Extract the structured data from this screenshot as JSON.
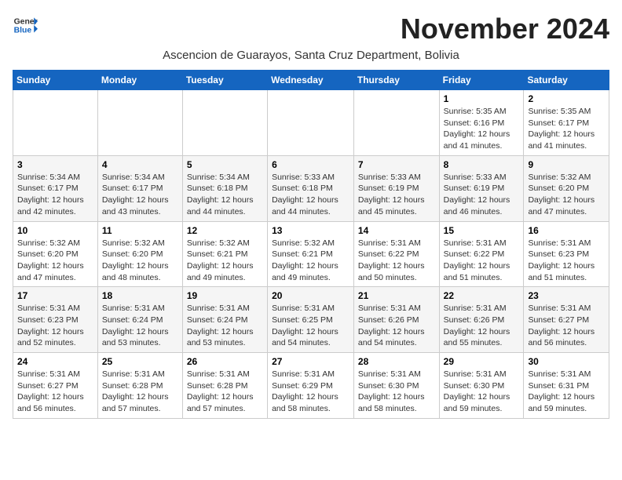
{
  "logo": {
    "line1": "General",
    "line2": "Blue"
  },
  "title": "November 2024",
  "subtitle": "Ascencion de Guarayos, Santa Cruz Department, Bolivia",
  "weekdays": [
    "Sunday",
    "Monday",
    "Tuesday",
    "Wednesday",
    "Thursday",
    "Friday",
    "Saturday"
  ],
  "weeks": [
    [
      {
        "day": "",
        "info": ""
      },
      {
        "day": "",
        "info": ""
      },
      {
        "day": "",
        "info": ""
      },
      {
        "day": "",
        "info": ""
      },
      {
        "day": "",
        "info": ""
      },
      {
        "day": "1",
        "info": "Sunrise: 5:35 AM\nSunset: 6:16 PM\nDaylight: 12 hours\nand 41 minutes."
      },
      {
        "day": "2",
        "info": "Sunrise: 5:35 AM\nSunset: 6:17 PM\nDaylight: 12 hours\nand 41 minutes."
      }
    ],
    [
      {
        "day": "3",
        "info": "Sunrise: 5:34 AM\nSunset: 6:17 PM\nDaylight: 12 hours\nand 42 minutes."
      },
      {
        "day": "4",
        "info": "Sunrise: 5:34 AM\nSunset: 6:17 PM\nDaylight: 12 hours\nand 43 minutes."
      },
      {
        "day": "5",
        "info": "Sunrise: 5:34 AM\nSunset: 6:18 PM\nDaylight: 12 hours\nand 44 minutes."
      },
      {
        "day": "6",
        "info": "Sunrise: 5:33 AM\nSunset: 6:18 PM\nDaylight: 12 hours\nand 44 minutes."
      },
      {
        "day": "7",
        "info": "Sunrise: 5:33 AM\nSunset: 6:19 PM\nDaylight: 12 hours\nand 45 minutes."
      },
      {
        "day": "8",
        "info": "Sunrise: 5:33 AM\nSunset: 6:19 PM\nDaylight: 12 hours\nand 46 minutes."
      },
      {
        "day": "9",
        "info": "Sunrise: 5:32 AM\nSunset: 6:20 PM\nDaylight: 12 hours\nand 47 minutes."
      }
    ],
    [
      {
        "day": "10",
        "info": "Sunrise: 5:32 AM\nSunset: 6:20 PM\nDaylight: 12 hours\nand 47 minutes."
      },
      {
        "day": "11",
        "info": "Sunrise: 5:32 AM\nSunset: 6:20 PM\nDaylight: 12 hours\nand 48 minutes."
      },
      {
        "day": "12",
        "info": "Sunrise: 5:32 AM\nSunset: 6:21 PM\nDaylight: 12 hours\nand 49 minutes."
      },
      {
        "day": "13",
        "info": "Sunrise: 5:32 AM\nSunset: 6:21 PM\nDaylight: 12 hours\nand 49 minutes."
      },
      {
        "day": "14",
        "info": "Sunrise: 5:31 AM\nSunset: 6:22 PM\nDaylight: 12 hours\nand 50 minutes."
      },
      {
        "day": "15",
        "info": "Sunrise: 5:31 AM\nSunset: 6:22 PM\nDaylight: 12 hours\nand 51 minutes."
      },
      {
        "day": "16",
        "info": "Sunrise: 5:31 AM\nSunset: 6:23 PM\nDaylight: 12 hours\nand 51 minutes."
      }
    ],
    [
      {
        "day": "17",
        "info": "Sunrise: 5:31 AM\nSunset: 6:23 PM\nDaylight: 12 hours\nand 52 minutes."
      },
      {
        "day": "18",
        "info": "Sunrise: 5:31 AM\nSunset: 6:24 PM\nDaylight: 12 hours\nand 53 minutes."
      },
      {
        "day": "19",
        "info": "Sunrise: 5:31 AM\nSunset: 6:24 PM\nDaylight: 12 hours\nand 53 minutes."
      },
      {
        "day": "20",
        "info": "Sunrise: 5:31 AM\nSunset: 6:25 PM\nDaylight: 12 hours\nand 54 minutes."
      },
      {
        "day": "21",
        "info": "Sunrise: 5:31 AM\nSunset: 6:26 PM\nDaylight: 12 hours\nand 54 minutes."
      },
      {
        "day": "22",
        "info": "Sunrise: 5:31 AM\nSunset: 6:26 PM\nDaylight: 12 hours\nand 55 minutes."
      },
      {
        "day": "23",
        "info": "Sunrise: 5:31 AM\nSunset: 6:27 PM\nDaylight: 12 hours\nand 56 minutes."
      }
    ],
    [
      {
        "day": "24",
        "info": "Sunrise: 5:31 AM\nSunset: 6:27 PM\nDaylight: 12 hours\nand 56 minutes."
      },
      {
        "day": "25",
        "info": "Sunrise: 5:31 AM\nSunset: 6:28 PM\nDaylight: 12 hours\nand 57 minutes."
      },
      {
        "day": "26",
        "info": "Sunrise: 5:31 AM\nSunset: 6:28 PM\nDaylight: 12 hours\nand 57 minutes."
      },
      {
        "day": "27",
        "info": "Sunrise: 5:31 AM\nSunset: 6:29 PM\nDaylight: 12 hours\nand 58 minutes."
      },
      {
        "day": "28",
        "info": "Sunrise: 5:31 AM\nSunset: 6:30 PM\nDaylight: 12 hours\nand 58 minutes."
      },
      {
        "day": "29",
        "info": "Sunrise: 5:31 AM\nSunset: 6:30 PM\nDaylight: 12 hours\nand 59 minutes."
      },
      {
        "day": "30",
        "info": "Sunrise: 5:31 AM\nSunset: 6:31 PM\nDaylight: 12 hours\nand 59 minutes."
      }
    ]
  ]
}
